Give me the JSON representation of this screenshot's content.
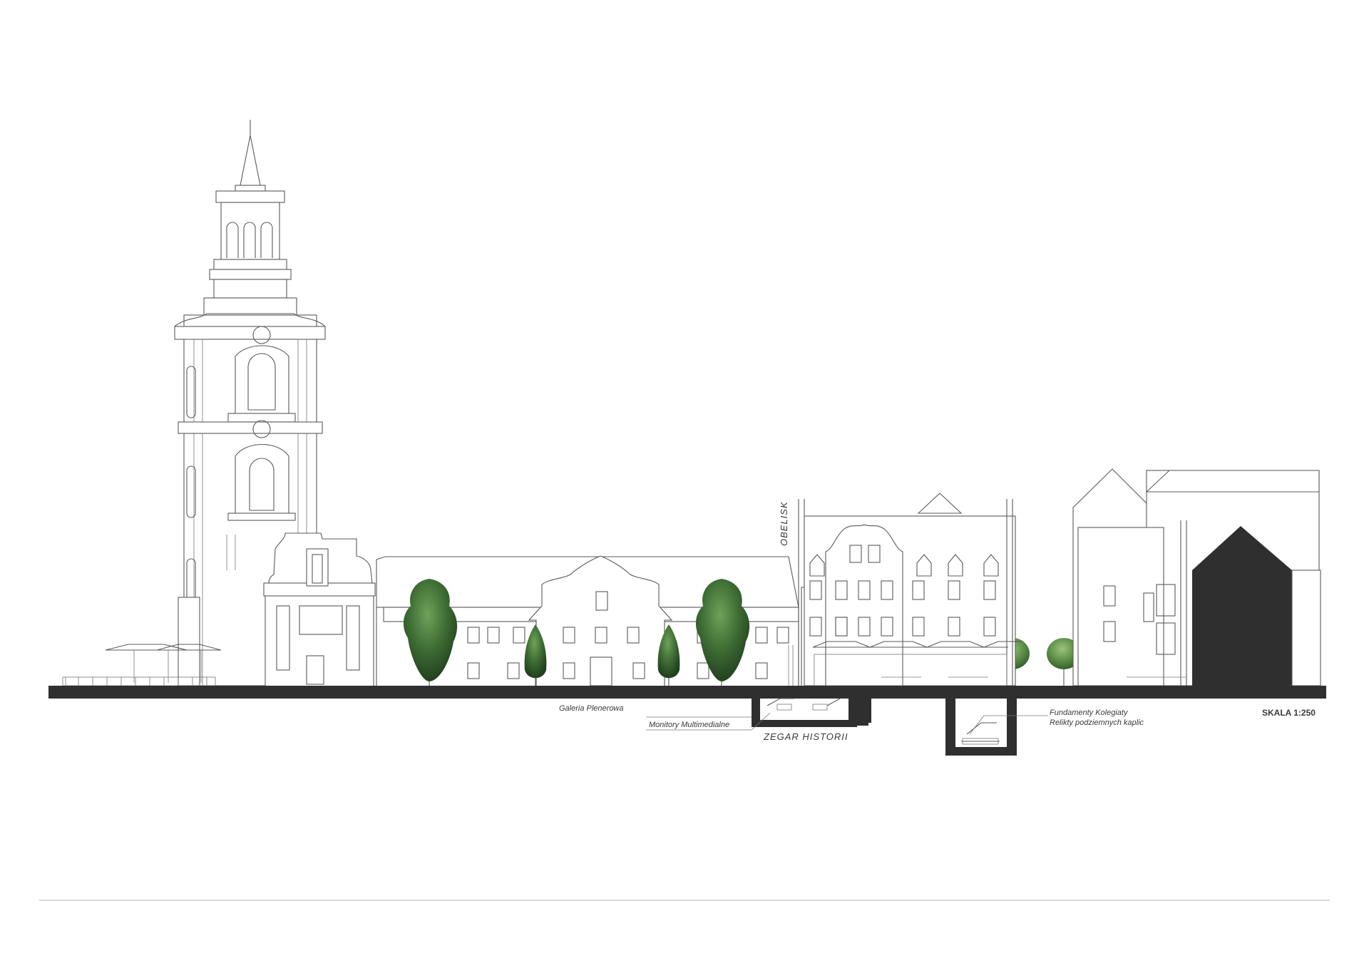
{
  "diagram": {
    "type": "architectural-elevation",
    "labels": {
      "gallery": "Galeria Plenerowa",
      "monitors": "Monitory Multimedialne",
      "clock": "ZEGAR HISTORII",
      "obelisk": "OBELISK",
      "foundations": "Fundamenty Kolegiaty",
      "relics": "Relikty podziemnych kaplic",
      "scale": "SKALA 1:250"
    },
    "colors": {
      "line": "#5a5a5a",
      "ground": "#2f2f2f",
      "tree_foliage": "#2f5a2a",
      "tree_light": "#4f8a3e"
    }
  }
}
